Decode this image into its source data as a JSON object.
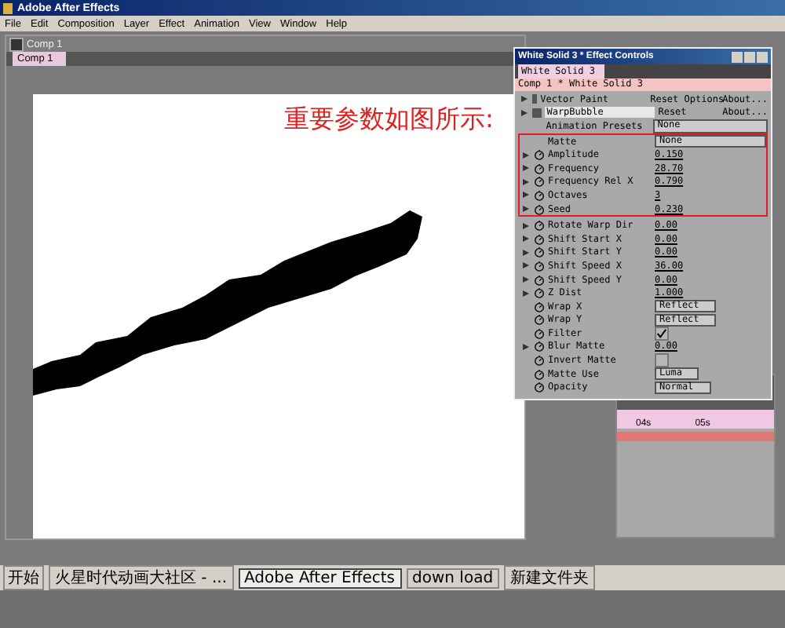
{
  "window": {
    "title": "Adobe After Effects"
  },
  "menu": [
    "File",
    "Edit",
    "Composition",
    "Layer",
    "Effect",
    "Animation",
    "View",
    "Window",
    "Help"
  ],
  "comp_window": {
    "title": "Comp 1",
    "tab": "Comp 1",
    "annotation": "重要参数如图所示:"
  },
  "effect_controls": {
    "title": "White Solid 3 * Effect Controls",
    "tab": "White Solid 3",
    "breadcrumb": "Comp 1 * White Solid 3",
    "effects": [
      {
        "name": "Vector Paint",
        "selected": false,
        "reset": "Reset Options",
        "about": "About..."
      },
      {
        "name": "WarpBubble",
        "selected": true,
        "reset": "Reset",
        "about": "About..."
      }
    ],
    "presets": {
      "label": "Animation Presets",
      "value": "None"
    },
    "groups": [
      {
        "highlighted": true,
        "rows": [
          {
            "kind": "dropdown",
            "name": "Matte",
            "value": "None",
            "expander": false,
            "stopwatch": false
          },
          {
            "kind": "value",
            "name": "Amplitude",
            "value": "0.150",
            "expander": true,
            "stopwatch": true
          },
          {
            "kind": "value",
            "name": "Frequency",
            "value": "28.70",
            "expander": true,
            "stopwatch": true
          },
          {
            "kind": "value",
            "name": "Frequency Rel X",
            "value": "0.790",
            "expander": true,
            "stopwatch": true
          },
          {
            "kind": "value",
            "name": "Octaves",
            "value": "3",
            "expander": true,
            "stopwatch": true
          },
          {
            "kind": "value",
            "name": "Seed",
            "value": "0.230",
            "expander": true,
            "stopwatch": true
          }
        ]
      },
      {
        "highlighted": false,
        "rows": [
          {
            "kind": "value",
            "name": "Rotate Warp Dir",
            "value": "0.00",
            "expander": true,
            "stopwatch": true
          },
          {
            "kind": "value",
            "name": "Shift Start X",
            "value": "0.00",
            "expander": true,
            "stopwatch": true
          },
          {
            "kind": "value",
            "name": "Shift Start Y",
            "value": "0.00",
            "expander": true,
            "stopwatch": true
          },
          {
            "kind": "value",
            "name": "Shift Speed X",
            "value": "36.00",
            "expander": true,
            "stopwatch": true
          },
          {
            "kind": "value",
            "name": "Shift Speed Y",
            "value": "0.00",
            "expander": true,
            "stopwatch": true
          },
          {
            "kind": "value",
            "name": "Z Dist",
            "value": "1.000",
            "expander": true,
            "stopwatch": true
          },
          {
            "kind": "dropdown",
            "name": "Wrap X",
            "value": "Reflect",
            "expander": false,
            "stopwatch": true
          },
          {
            "kind": "dropdown",
            "name": "Wrap Y",
            "value": "Reflect",
            "expander": false,
            "stopwatch": true
          },
          {
            "kind": "checkbox",
            "name": "Filter",
            "checked": true,
            "expander": false,
            "stopwatch": true
          },
          {
            "kind": "value",
            "name": "Blur Matte",
            "value": "0.00",
            "expander": true,
            "stopwatch": true
          },
          {
            "kind": "checkbox",
            "name": "Invert Matte",
            "checked": false,
            "expander": false,
            "stopwatch": true
          },
          {
            "kind": "dropdown",
            "name": "Matte Use",
            "value": "Luma",
            "expander": false,
            "stopwatch": true
          },
          {
            "kind": "dropdown",
            "name": "Opacity",
            "value": "Normal",
            "expander": false,
            "stopwatch": true
          }
        ]
      }
    ]
  },
  "timeline": {
    "ticks": [
      "04s",
      "05s"
    ]
  },
  "taskbar": {
    "start": "开始",
    "items": [
      {
        "label": "火星时代动画大社区 - ...",
        "selected": false
      },
      {
        "label": "Adobe After Effects",
        "selected": true
      },
      {
        "label": "down load",
        "selected": false
      },
      {
        "label": "新建文件夹",
        "selected": false
      }
    ]
  }
}
